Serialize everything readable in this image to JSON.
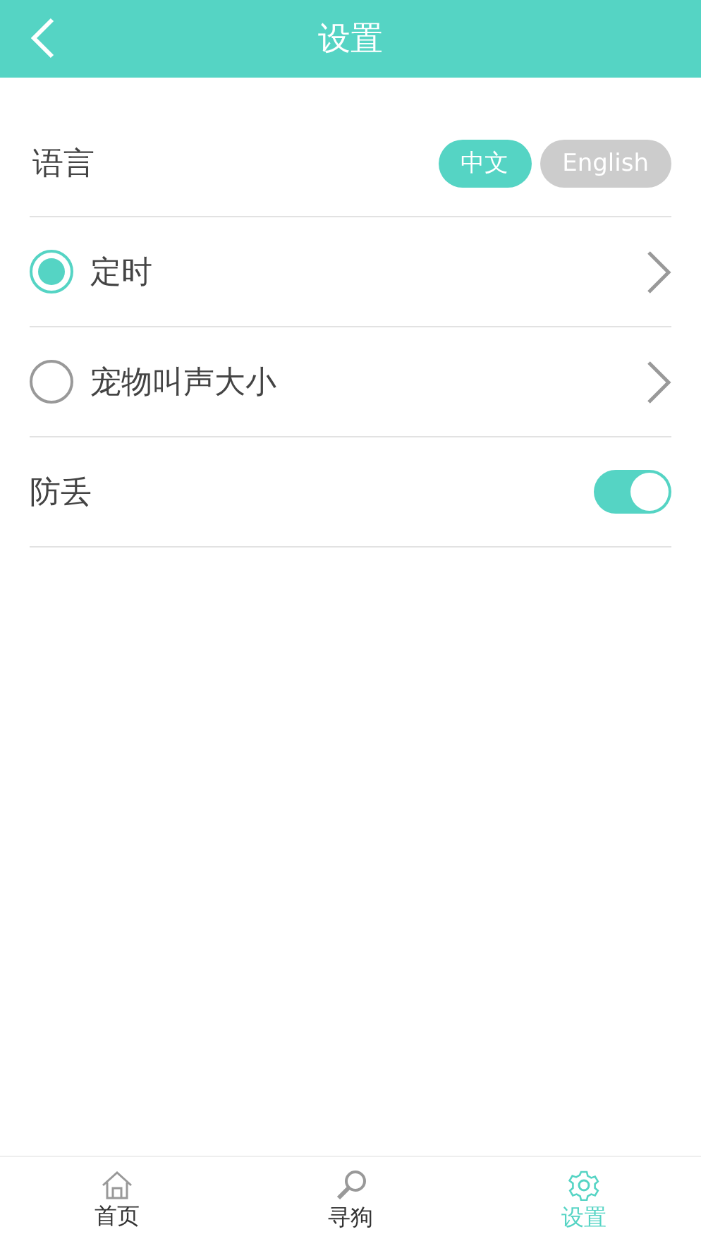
{
  "header": {
    "title": "设置"
  },
  "language": {
    "label": "语言",
    "options": [
      {
        "label": "中文",
        "selected": true
      },
      {
        "label": "English",
        "selected": false
      }
    ]
  },
  "options": [
    {
      "label": "定时",
      "selected": true
    },
    {
      "label": "宠物叫声大小",
      "selected": false
    }
  ],
  "anti_loss": {
    "label": "防丢",
    "on": true
  },
  "tabs": [
    {
      "kind": "home",
      "label": "首页",
      "selected": false
    },
    {
      "kind": "search",
      "label": "寻狗",
      "selected": false
    },
    {
      "kind": "settings",
      "label": "设置",
      "selected": true
    }
  ]
}
